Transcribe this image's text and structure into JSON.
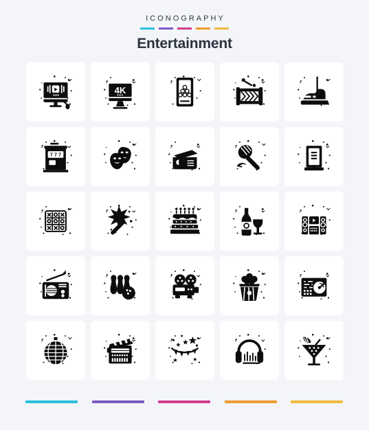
{
  "header": {
    "kicker": "ICONOGRAPHY",
    "title": "Entertainment",
    "accent_rules": [
      {
        "name": "rule-cyan",
        "color": "#29c0dd"
      },
      {
        "name": "rule-purple",
        "color": "#7b5bc4"
      },
      {
        "name": "rule-magenta",
        "color": "#cf3d91"
      },
      {
        "name": "rule-orange",
        "color": "#ef9b32"
      },
      {
        "name": "rule-yellow",
        "color": "#f2b93f"
      }
    ]
  },
  "grid": {
    "columns": 5,
    "rows": 5,
    "card_background": "#ffffff",
    "icon_color": "#0d0d0d",
    "icons": [
      {
        "name": "monitor-play-icon",
        "label": "Monitor Video Player"
      },
      {
        "name": "monitor-4k-icon",
        "label": "4K Monitor"
      },
      {
        "name": "billiards-table-icon",
        "label": "Billiards Table"
      },
      {
        "name": "drum-icon",
        "label": "Drum"
      },
      {
        "name": "bumper-car-icon",
        "label": "Bumper Car"
      },
      {
        "name": "slot-machine-icon",
        "label": "Slot Machine"
      },
      {
        "name": "theater-masks-icon",
        "label": "Theater Masks"
      },
      {
        "name": "tickets-icon",
        "label": "Tickets"
      },
      {
        "name": "microphone-icon",
        "label": "Microphone"
      },
      {
        "name": "book-icon",
        "label": "Book"
      },
      {
        "name": "tic-tac-toe-icon",
        "label": "Tic Tac Toe"
      },
      {
        "name": "magic-wand-icon",
        "label": "Magic Wand"
      },
      {
        "name": "cake-icon",
        "label": "Cake"
      },
      {
        "name": "wine-bottle-glass-icon",
        "label": "Wine Bottle And Glass"
      },
      {
        "name": "home-theater-icon",
        "label": "Home Theater System"
      },
      {
        "name": "radio-icon",
        "label": "Radio"
      },
      {
        "name": "bowling-icon",
        "label": "Bowling"
      },
      {
        "name": "film-projector-icon",
        "label": "Film Projector"
      },
      {
        "name": "popcorn-icon",
        "label": "Popcorn"
      },
      {
        "name": "dj-turntable-icon",
        "label": "DJ Turntable"
      },
      {
        "name": "disco-ball-icon",
        "label": "Disco Ball"
      },
      {
        "name": "clapperboard-icon",
        "label": "Clapperboard"
      },
      {
        "name": "party-bunting-icon",
        "label": "Party Bunting"
      },
      {
        "name": "headphones-icon",
        "label": "Headphones"
      },
      {
        "name": "cocktail-icon",
        "label": "Cocktail"
      }
    ]
  },
  "footer": {
    "bars": [
      {
        "name": "footer-bar-cyan",
        "color": "#29c0dd"
      },
      {
        "name": "footer-bar-purple",
        "color": "#7b5bc4"
      },
      {
        "name": "footer-bar-magenta",
        "color": "#cf3d91"
      },
      {
        "name": "footer-bar-orange",
        "color": "#ef9b32"
      },
      {
        "name": "footer-bar-yellow",
        "color": "#f2b93f"
      }
    ]
  },
  "page": {
    "background": "#f4f5f9"
  }
}
